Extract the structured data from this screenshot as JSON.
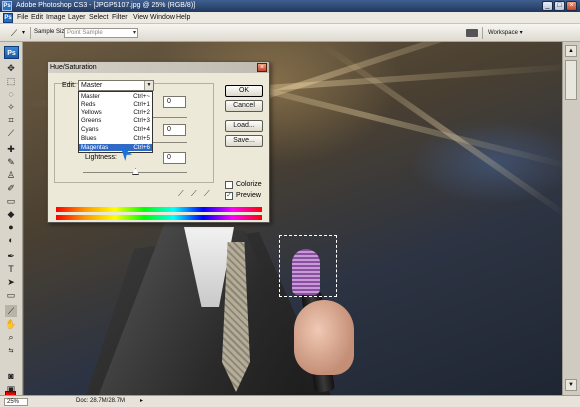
{
  "window": {
    "title": "Adobe Photoshop CS3 - [JPGP5107.jpg @ 25% (RGB/8)]",
    "logo": "Ps",
    "controls": [
      "_",
      "□",
      "×"
    ]
  },
  "menu": {
    "logo": "Ps",
    "items": [
      "File",
      "Edit",
      "Image",
      "Layer",
      "Select",
      "Filter",
      "View",
      "Window",
      "Help"
    ]
  },
  "options": {
    "sample_size_label": "Sample Size:",
    "sample_size_value": "Point Sample",
    "workspace_label": "Workspace ▾"
  },
  "toolbox": {
    "logo": "Ps",
    "foreground_color": "#ff0000",
    "background_color": "#ffffff"
  },
  "status": {
    "zoom": "25%",
    "doc": "Doc: 28.7M/28.7M"
  },
  "dialog": {
    "title": "Hue/Saturation",
    "edit_label": "Edit:",
    "edit_value": "Master",
    "lightness_label": "Lightness:",
    "values": [
      "0",
      "0",
      "0"
    ],
    "buttons": {
      "ok": "OK",
      "cancel": "Cancel",
      "load": "Load...",
      "save": "Save..."
    },
    "colorize_label": "Colorize",
    "preview_label": "Preview",
    "preview_checked": "✓",
    "eyedroppers": [
      "eyedropper",
      "eyedropper-plus",
      "eyedropper-minus"
    ]
  },
  "dropdown": {
    "items": [
      {
        "label": "Master",
        "shortcut": "Ctrl+~"
      },
      {
        "label": "Reds",
        "shortcut": "Ctrl+1"
      },
      {
        "label": "Yellows",
        "shortcut": "Ctrl+2"
      },
      {
        "label": "Greens",
        "shortcut": "Ctrl+3"
      },
      {
        "label": "Cyans",
        "shortcut": "Ctrl+4"
      },
      {
        "label": "Blues",
        "shortcut": "Ctrl+5"
      },
      {
        "label": "Magentas",
        "shortcut": "Ctrl+6"
      }
    ],
    "selected": "Magentas"
  }
}
